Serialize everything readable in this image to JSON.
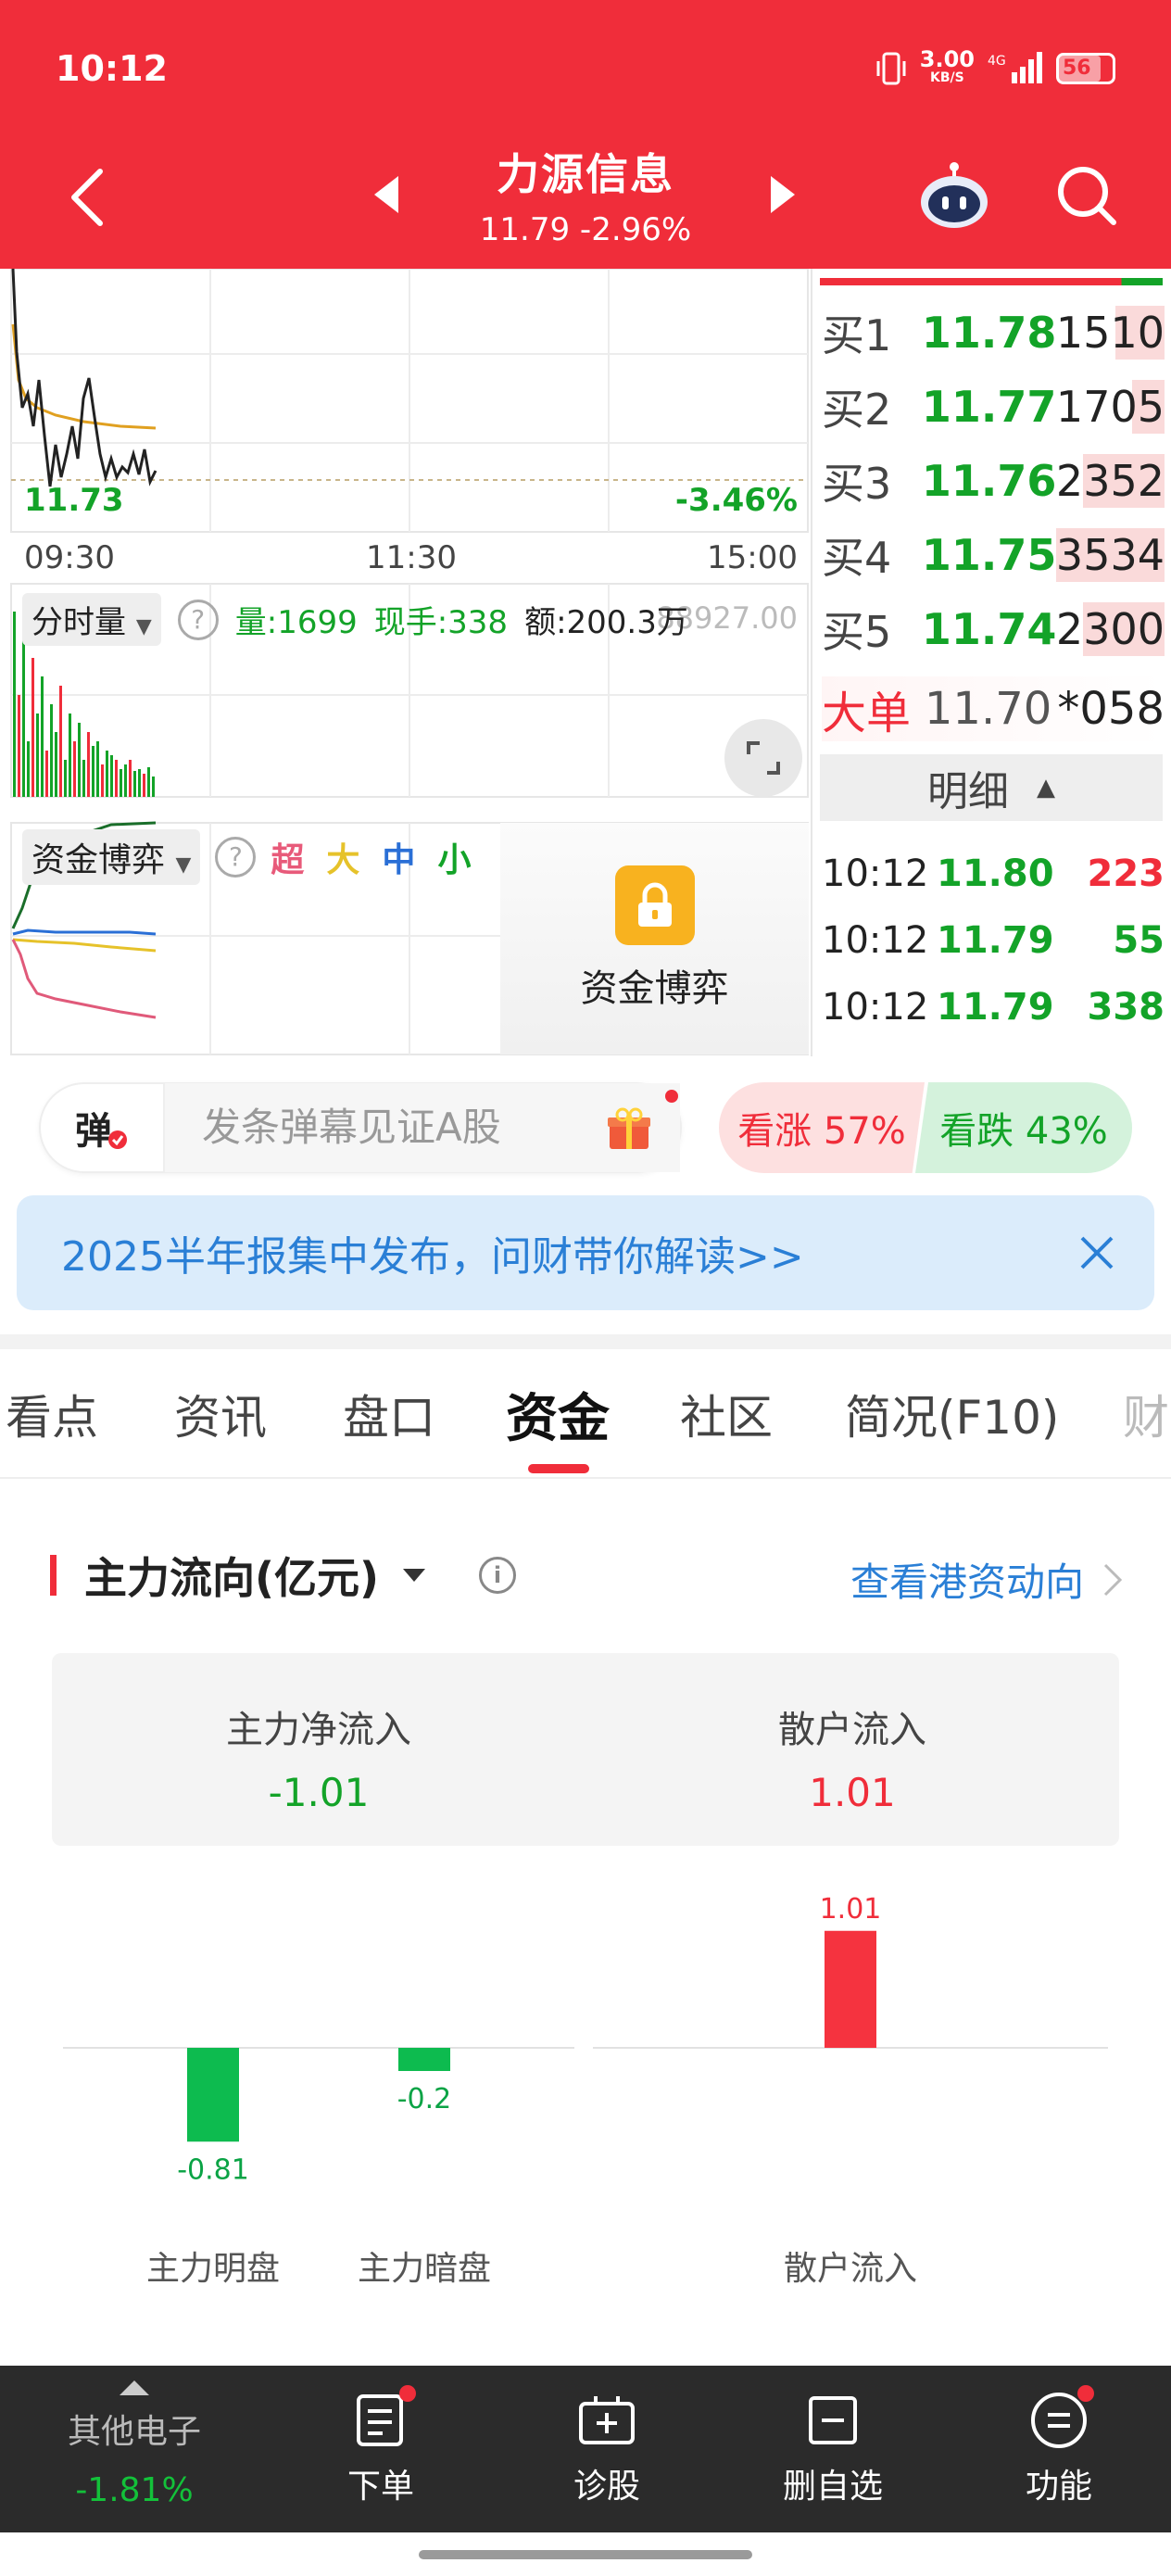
{
  "status": {
    "time": "10:12",
    "net_speed": "3.00",
    "net_unit": "KB/S",
    "net_type": "4G",
    "battery": "56"
  },
  "header": {
    "title": "力源信息",
    "subtitle": "11.79  -2.96%"
  },
  "chart": {
    "price_low": "11.73",
    "pct_low": "-3.46%",
    "time_labels": [
      "09:30",
      "11:30",
      "15:00"
    ],
    "vol_mode": "分时量",
    "vol_text": "量:1699",
    "now_hand": "现手:338",
    "amount": "额:200.3万",
    "vol_axis": "88927.00",
    "fund_mode": "资金博弈",
    "fund_filters": [
      {
        "label": "超",
        "color": "#e85a7a"
      },
      {
        "label": "大",
        "color": "#e6c22a"
      },
      {
        "label": "中",
        "color": "#2a6fd6"
      },
      {
        "label": "小",
        "color": "#13a328"
      }
    ],
    "lock_text": "资金博弈"
  },
  "order_book": {
    "bids": [
      {
        "label": "买1",
        "price": "11.78",
        "volume": "1510",
        "fill": 0.45
      },
      {
        "label": "买2",
        "price": "11.77",
        "volume": "1705",
        "fill": 0.3
      },
      {
        "label": "买3",
        "price": "11.76",
        "volume": "2352",
        "fill": 0.75
      },
      {
        "label": "买4",
        "price": "11.75",
        "volume": "3534",
        "fill": 1.0
      },
      {
        "label": "买5",
        "price": "11.74",
        "volume": "2300",
        "fill": 0.75
      }
    ],
    "big_order": {
      "label": "大单",
      "price": "11.70",
      "volume": "*058"
    },
    "detail_tab": "明细",
    "ticks": [
      {
        "time": "10:12",
        "price": "11.80",
        "volume": "223",
        "color": "#f02d3a"
      },
      {
        "time": "10:12",
        "price": "11.79",
        "volume": "55",
        "color": "#13a328"
      },
      {
        "time": "10:12",
        "price": "11.79",
        "volume": "338",
        "color": "#13a328"
      }
    ]
  },
  "danmaku": {
    "button": "弹",
    "placeholder": "发条弹幕见证A股"
  },
  "sentiment": {
    "bull": "看涨 57%",
    "bear": "看跌 43%"
  },
  "banner": {
    "text": "2025半年报集中发布，问财带你解读>>"
  },
  "tabs": [
    "看点",
    "资讯",
    "盘口",
    "资金",
    "社区",
    "简况(F10)",
    "财"
  ],
  "fund_flow": {
    "title": "主力流向(亿元)",
    "link": "查看港资动向",
    "net_inflow_label": "主力净流入",
    "net_inflow_value": "-1.01",
    "retail_label": "散户流入",
    "retail_value": "1.01"
  },
  "chart_data": {
    "type": "bar",
    "categories": [
      "主力明盘",
      "主力暗盘",
      "散户流入"
    ],
    "values": [
      -0.81,
      -0.2,
      1.01
    ],
    "value_labels": [
      "-0.81",
      "-0.2",
      "1.01"
    ],
    "colors": [
      "#0dbb4f",
      "#0dbb4f",
      "#f5333f"
    ]
  },
  "bottom_nav": {
    "sector_name": "其他电子",
    "sector_change": "-1.81%",
    "items": [
      {
        "label": "下单",
        "icon": "order-icon",
        "dot": true
      },
      {
        "label": "诊股",
        "icon": "diagnose-icon",
        "dot": false
      },
      {
        "label": "删自选",
        "icon": "remove-watchlist-icon",
        "dot": false
      },
      {
        "label": "功能",
        "icon": "menu-icon",
        "dot": true
      }
    ]
  }
}
